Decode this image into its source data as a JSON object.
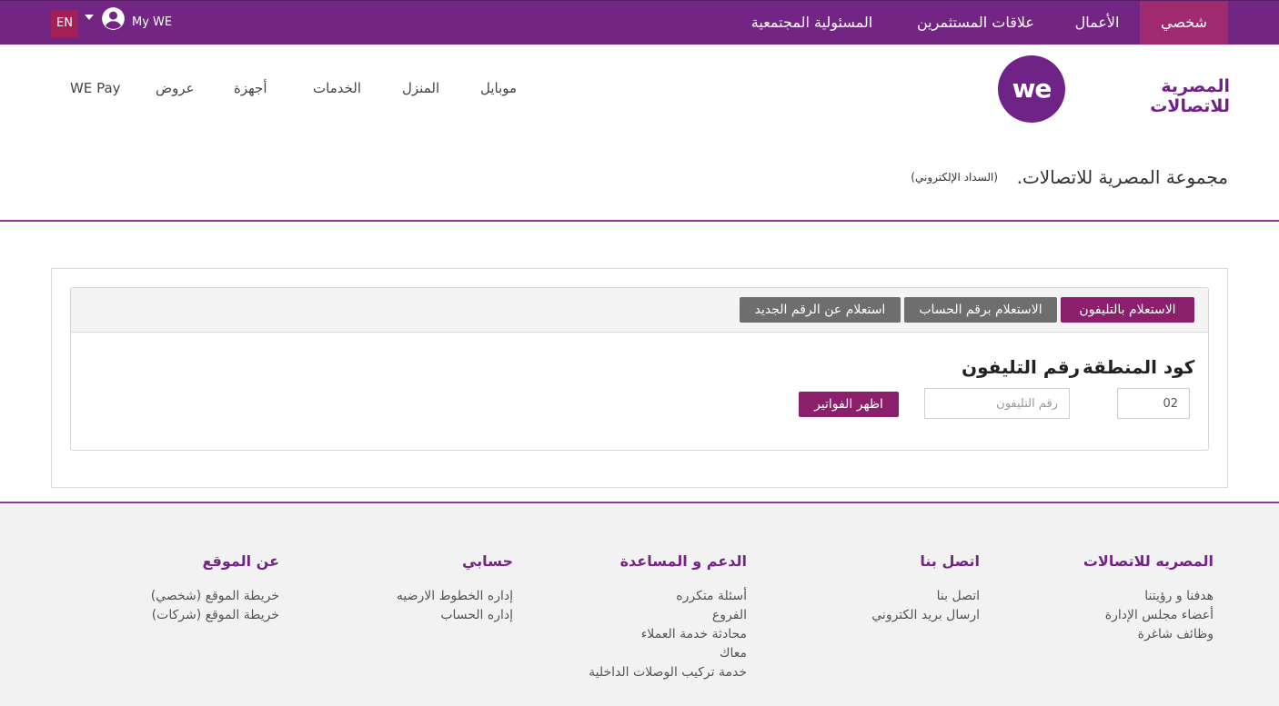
{
  "topbar": {
    "lang": "EN",
    "my_we": "My WE",
    "tabs": [
      "شخصي",
      "الأعمال",
      "علاقات المستثمرين",
      "المسئولية المجتمعية"
    ]
  },
  "brand": {
    "logo_mark": "we",
    "logo_text": "المصرية للاتصالات",
    "color": "#732583",
    "accent": "#8c1f6b"
  },
  "nav": {
    "items": [
      "موبايل",
      "المنزل",
      "الخدمات",
      "أجهزة",
      "عروض",
      "WE Pay"
    ]
  },
  "page": {
    "title": "مجموعة المصرية للاتصالات.",
    "subtitle": "(السداد الإلكتروني)"
  },
  "inquiry": {
    "tabs": [
      "الاستعلام بالتليفون",
      "الاستعلام برقم الحساب",
      "استعلام عن الرقم الجديد"
    ],
    "area_code_label": "كود المنطقة",
    "phone_label": "رقم التليفون",
    "area_code_value": "02",
    "phone_placeholder": "رقم التليفون",
    "submit": "اظهر الفواتير"
  },
  "footer": {
    "columns": [
      {
        "title": "المصريه للاتصالات",
        "links": [
          "هدفنا و رؤيتنا",
          "أعضاء مجلس الإدارة",
          "وظائف شاغرة"
        ]
      },
      {
        "title": "اتصل بنا",
        "links": [
          "اتصل بنا",
          "ارسال بريد الكتروني"
        ]
      },
      {
        "title": "الدعم و المساعدة",
        "links": [
          "أسئلة متكرره",
          "الفروع",
          "محادثة خدمة العملاء",
          "معاك",
          "خدمة تركيب الوصلات الداخلية"
        ]
      },
      {
        "title": "حسابي",
        "links": [
          "إداره الخطوط الارضيه",
          "إداره الحساب"
        ]
      },
      {
        "title": "عن الموقع",
        "links": [
          "خريطة الموقع (شخصي)",
          "خريطة الموقع (شركات)"
        ]
      }
    ]
  }
}
